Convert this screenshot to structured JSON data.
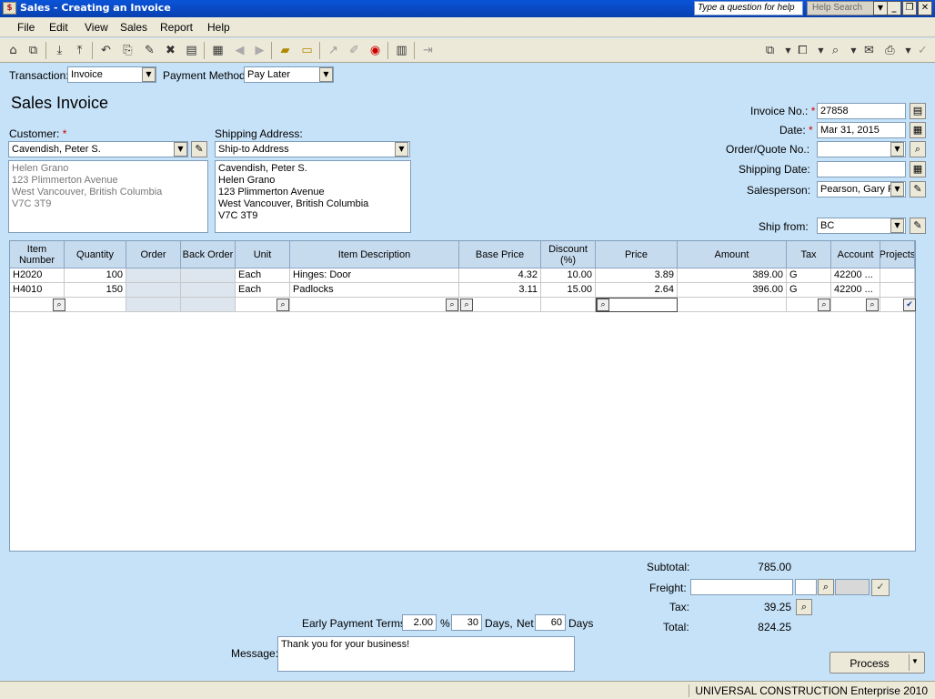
{
  "window": {
    "title": "Sales - Creating an Invoice",
    "question_placeholder": "Type a question for help",
    "help_search": "Help Search"
  },
  "menu": [
    "File",
    "Edit",
    "View",
    "Sales",
    "Report",
    "Help"
  ],
  "transaction": {
    "label": "Transaction:",
    "value": "Invoice"
  },
  "payment_method": {
    "label": "Payment Method:",
    "value": "Pay Later"
  },
  "form_title": "Sales Invoice",
  "customer": {
    "label": "Customer:",
    "value": "Cavendish, Peter S.",
    "address": [
      "Helen Grano",
      "123 Plimmerton Avenue",
      "West Vancouver, British Columbia",
      "V7C 3T9"
    ]
  },
  "shipping": {
    "label": "Shipping Address:",
    "value": "Ship-to Address",
    "address": [
      "Cavendish, Peter S.",
      "Helen Grano",
      "123 Plimmerton Avenue",
      "West Vancouver, British Columbia",
      "V7C 3T9"
    ]
  },
  "invoice_no": {
    "label": "Invoice No.:",
    "value": "27858"
  },
  "date": {
    "label": "Date:",
    "value": "Mar 31, 2015"
  },
  "order_quote": {
    "label": "Order/Quote No.:",
    "value": ""
  },
  "shipping_date": {
    "label": "Shipping Date:",
    "value": ""
  },
  "salesperson": {
    "label": "Salesperson:",
    "value": "Pearson, Gary P"
  },
  "ship_from": {
    "label": "Ship from:",
    "value": "BC"
  },
  "grid": {
    "headers": [
      "Item Number",
      "Quantity",
      "Order",
      "Back Order",
      "Unit",
      "Item Description",
      "Base Price",
      "Discount (%)",
      "Price",
      "Amount",
      "Tax",
      "Account",
      "Projects"
    ],
    "rows": [
      [
        "H2020",
        "100",
        "",
        "",
        "Each",
        "Hinges: Door",
        "4.32",
        "10.00",
        "3.89",
        "389.00",
        "G",
        "42200 ..."
      ],
      [
        "H4010",
        "150",
        "",
        "",
        "Each",
        "Padlocks",
        "3.11",
        "15.00",
        "2.64",
        "396.00",
        "G",
        "42200 ..."
      ]
    ]
  },
  "totals": {
    "subtotal_label": "Subtotal:",
    "subtotal": "785.00",
    "freight_label": "Freight:",
    "tax_label": "Tax:",
    "tax": "39.25",
    "total_label": "Total:",
    "total": "824.25"
  },
  "terms": {
    "label": "Early Payment Terms:",
    "percent": "2.00",
    "pct_sym": "%",
    "days": "30",
    "days_label": "Days,",
    "net_label": "Net",
    "net": "60",
    "net_days_label": "Days"
  },
  "message": {
    "label": "Message:",
    "value": "Thank you for your business!"
  },
  "process_label": "Process",
  "status_text": "UNIVERSAL CONSTRUCTION Enterprise 2010"
}
